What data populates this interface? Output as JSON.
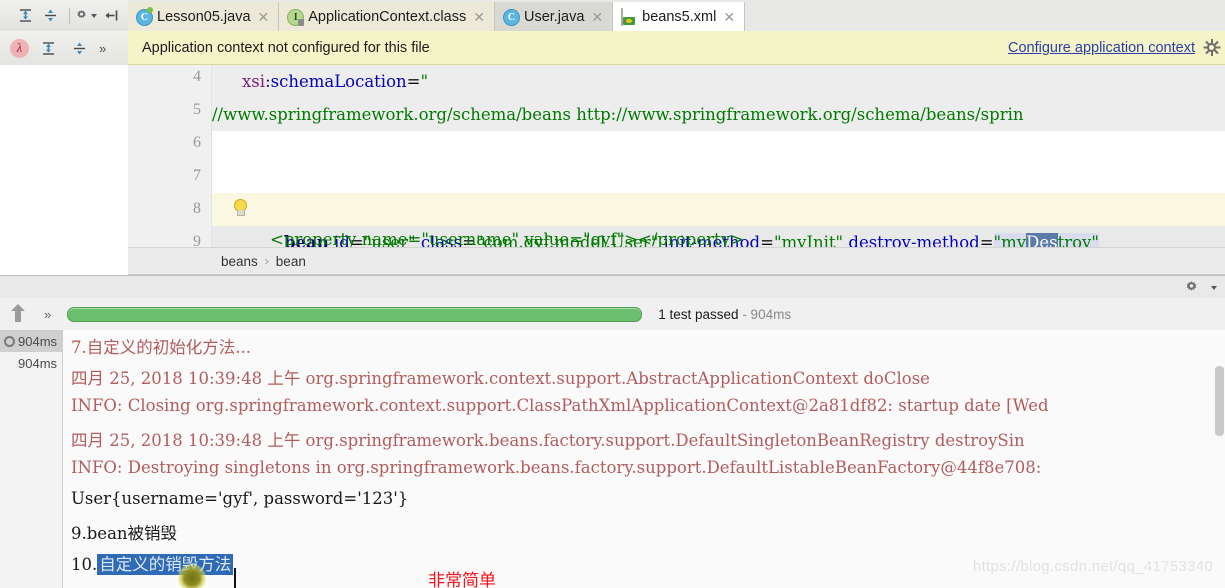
{
  "toolbar": {
    "icons": [
      {
        "name": "expand-all-icon",
        "glyph": "⊺"
      },
      {
        "name": "collapse-all-icon",
        "glyph": "⊼"
      },
      {
        "name": "settings-icon",
        "glyph": "gear"
      },
      {
        "name": "jump-to-source-icon",
        "glyph": "|←"
      }
    ],
    "secondary_icons": [
      {
        "name": "lambda-icon",
        "glyph": "λ"
      },
      {
        "name": "expand-selection-icon",
        "glyph": "⇱"
      },
      {
        "name": "collapse-selection-icon",
        "glyph": "⇲"
      }
    ],
    "overflow_label": "»"
  },
  "tabs": [
    {
      "label": "Lesson05.java",
      "icon": "java-class-icon",
      "close": "✕",
      "state": "selected"
    },
    {
      "label": "ApplicationContext.class",
      "icon": "java-interface-locked-icon",
      "close": "✕",
      "state": "selected"
    },
    {
      "label": "User.java",
      "icon": "java-class-icon",
      "close": "✕",
      "state": "inactive"
    },
    {
      "label": "beans5.xml",
      "icon": "spring-xml-icon",
      "close": "✕",
      "state": "active"
    }
  ],
  "banner": {
    "message": "Application context not configured for this file",
    "link": "Configure application context",
    "gear": "gear-icon"
  },
  "editor": {
    "lines": [
      {
        "num": "4",
        "text": "xsi:schemaLocation=\""
      },
      {
        "num": "5",
        "text": "//www.springframework.org/schema/beans http://www.springframework.org/schema/beans/sprin"
      },
      {
        "num": "6",
        "text": ""
      },
      {
        "num": "7",
        "text": ""
      },
      {
        "num": "8",
        "text": "bean id=\"user\" class=\"com.gyf.model.User\" init-method=\"myInit\" destroy-method=\"myDestroy\""
      },
      {
        "num": "9",
        "text": "<property name=\"username\" value=\"gyf\"></property>"
      }
    ],
    "line4": {
      "ns": "xsi",
      "colon": ":",
      "attr": "schemaLocation",
      "eq": "=",
      "quote": "\""
    },
    "line5": {
      "url": "//www.springframework.org/schema/beans",
      "url2": "http://www.springframework.org/schema/beans/sprin"
    },
    "line8": {
      "tag": "bean",
      "a1": "id",
      "v1": "\"user\"",
      "a2": "class",
      "v2": "\"com.gyf.model.User\"",
      "a3": "init-method",
      "v3": "\"myInit\"",
      "a4": "destroy-method",
      "v4_open": "\"my",
      "v4_sel": "D",
      "v4_sel2": "es",
      "v4_rest": "troy",
      "v4_close": "\""
    },
    "line9": {
      "text": "<property name=\"username\" value=\"gyf\"></property>"
    }
  },
  "breadcrumb": {
    "items": [
      "beans",
      "bean"
    ],
    "separator": "›"
  },
  "run_panel": {
    "progress_pct": 100,
    "status": "1 test passed",
    "duration": "- 904ms",
    "up_icon": "rerun-failed-icon",
    "chevron": "»",
    "gear": "gear-icon",
    "tree": [
      {
        "duration": "904ms",
        "state": "selected"
      },
      {
        "duration": "904ms",
        "state": "normal"
      }
    ]
  },
  "console": {
    "lines": [
      {
        "text": "7.自定义的初始化方法...",
        "color": "log"
      },
      {
        "text": "四月 25, 2018 10:39:48 上午 org.springframework.context.support.AbstractApplicationContext doClose",
        "color": "log"
      },
      {
        "text": "INFO: Closing org.springframework.context.support.ClassPathXmlApplicationContext@2a81df82: startup date [Wed",
        "color": "log"
      },
      {
        "text": "四月 25, 2018 10:39:48 上午 org.springframework.beans.factory.support.DefaultSingletonBeanRegistry destroySin",
        "color": "log"
      },
      {
        "text": "INFO: Destroying singletons in org.springframework.beans.factory.support.DefaultListableBeanFactory@44f8e708:",
        "color": "log"
      },
      {
        "text": "User{username='gyf', password='123'}",
        "color": "black"
      },
      {
        "text": "9.bean被销毁",
        "color": "black"
      }
    ],
    "selected_line": {
      "prefix": "10.",
      "selection": "自定义的销毁方法"
    },
    "annotation": "非常简单",
    "annotation_color": "#f4121a"
  },
  "watermark": "https://blog.csdn.net/qq_41753340"
}
